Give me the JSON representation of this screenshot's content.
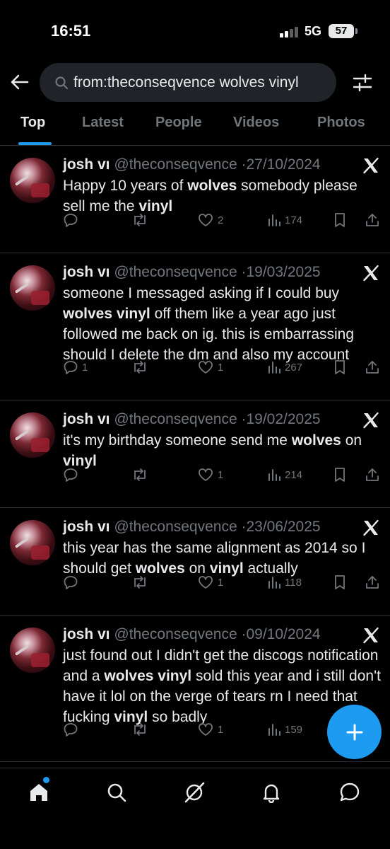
{
  "status_bar": {
    "time": "16:51",
    "network": "5G",
    "battery": "57"
  },
  "search": {
    "query": "from:theconseqvence wolves vinyl",
    "placeholder": "Search"
  },
  "tabs": [
    {
      "label": "Top",
      "active": true
    },
    {
      "label": "Latest",
      "active": false
    },
    {
      "label": "People",
      "active": false
    },
    {
      "label": "Videos",
      "active": false
    },
    {
      "label": "Photos",
      "active": false
    }
  ],
  "tweets": [
    {
      "name": "josh vı",
      "handle": "@theconseqvence",
      "date": "27/10/2024",
      "segments": [
        {
          "t": "Happy 10 years of ",
          "b": false
        },
        {
          "t": "wolves",
          "b": true
        },
        {
          "t": " somebody please sell me the ",
          "b": false
        },
        {
          "t": "vinyl",
          "b": true
        }
      ],
      "replies": "",
      "reposts": "",
      "likes": "2",
      "views": "174"
    },
    {
      "name": "josh vı",
      "handle": "@theconseqvence",
      "date": "19/03/2025",
      "segments": [
        {
          "t": "someone I messaged asking if I could buy ",
          "b": false
        },
        {
          "t": "wolves vinyl",
          "b": true
        },
        {
          "t": " off them like a year ago just followed me back on ig. this is embarrassing should I delete the dm and also my account",
          "b": false
        }
      ],
      "replies": "1",
      "reposts": "",
      "likes": "1",
      "views": "267"
    },
    {
      "name": "josh vı",
      "handle": "@theconseqvence",
      "date": "19/02/2025",
      "segments": [
        {
          "t": "it's my birthday someone send me ",
          "b": false
        },
        {
          "t": "wolves",
          "b": true
        },
        {
          "t": " on ",
          "b": false
        },
        {
          "t": "vinyl",
          "b": true
        }
      ],
      "replies": "",
      "reposts": "",
      "likes": "1",
      "views": "214"
    },
    {
      "name": "josh vı",
      "handle": "@theconseqvence",
      "date": "23/06/2025",
      "segments": [
        {
          "t": "this year has the same alignment as 2014 so I should get ",
          "b": false
        },
        {
          "t": "wolves",
          "b": true
        },
        {
          "t": " on ",
          "b": false
        },
        {
          "t": "vinyl",
          "b": true
        },
        {
          "t": " actually",
          "b": false
        }
      ],
      "replies": "",
      "reposts": "",
      "likes": "1",
      "views": "118"
    },
    {
      "name": "josh vı",
      "handle": "@theconseqvence",
      "date": "09/10/2024",
      "segments": [
        {
          "t": "just found out I didn't get the discogs notification and a ",
          "b": false
        },
        {
          "t": "wolves vinyl",
          "b": true
        },
        {
          "t": " sold this year and i still don't have it lol on the verge of tears rn I need that fucking ",
          "b": false
        },
        {
          "t": "vinyl",
          "b": true
        },
        {
          "t": " so badly",
          "b": false
        }
      ],
      "replies": "",
      "reposts": "",
      "likes": "1",
      "views": "159"
    }
  ],
  "colors": {
    "accent": "#1d9bf0",
    "background": "#000000",
    "secondary_text": "#71767b",
    "divider": "#2f3336"
  },
  "icons": {
    "back": "arrow-left-icon",
    "search": "search-icon",
    "filter": "filter-sliders-icon",
    "x": "x-logo-icon",
    "compose": "plus-icon",
    "nav": [
      "home-icon",
      "search-icon",
      "grok-icon",
      "notifications-bell-icon",
      "messages-bubble-icon"
    ]
  }
}
